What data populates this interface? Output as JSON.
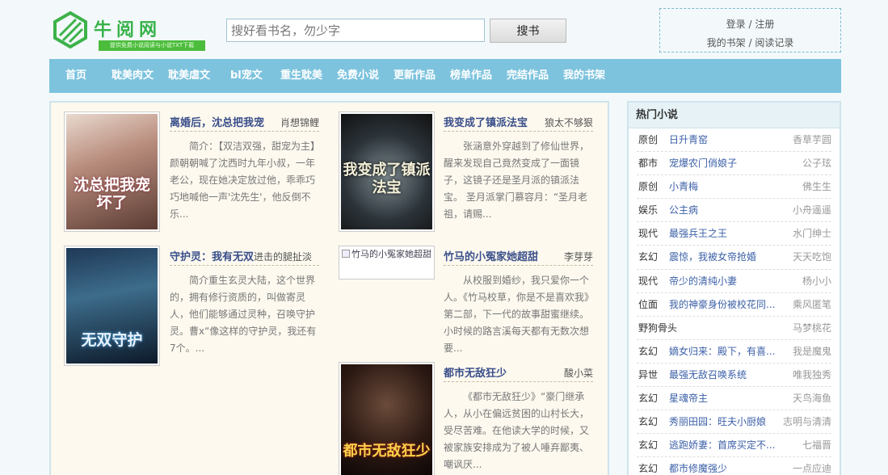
{
  "header": {
    "site_name": "牛阅网",
    "slogan": "提供免费小说阅读与小说TXT下载",
    "search_placeholder": "搜好看书名，勿少字",
    "search_button": "搜书",
    "login": "登录",
    "sep": " / ",
    "register": "注册",
    "bookshelf": "我的书架",
    "history": "阅读记录"
  },
  "nav": [
    "首页",
    "耽美肉文",
    "耽美虐文",
    "bl宠文",
    "重生耽美",
    "免费小说",
    "更新作品",
    "榜单作品",
    "完结作品",
    "我的书架"
  ],
  "books": [
    {
      "title": "离婚后，沈总把我宠",
      "author": "肖想锦鲤",
      "desc": "简介：【双洁双强，甜宠为主】颜朝朝喊了沈西时九年小叔，一年老公，现在她决定放过他，乖乖巧巧地喊他一声'沈先生'，他反倒不乐...",
      "cover_text": "沈总把我宠坏了"
    },
    {
      "title": "我变成了镇派法宝",
      "author": "狼太不够狠",
      "desc": "张涵意外穿越到了修仙世界，醒来发现自己竟然变成了一面镜子，这镜子还是圣月派的镇派法宝。 圣月派掌门慕容月：“圣月老祖，请赐...",
      "cover_text": "我变成了镇派法宝"
    },
    {
      "title": "守护灵：我有无双",
      "title_extra": "进击的腿扯淡",
      "author": "",
      "desc": "简介重生玄灵大陆，这个世界的，拥有修行资质的，叫做寄灵人，他们能够通过灵种，召唤守护灵。曹x“像这样的守护灵，我还有7个。...",
      "cover_text": "无双守护"
    },
    {
      "title": "竹马的小冤家她超甜",
      "author": "李芽芽",
      "desc": "从校服到婚纱，我只爱你一个人。《竹马校草，你是不是喜欢我》第二部，下一代的故事甜蜜继续。 小时候的路言溪每天都有无数次想要...",
      "cover_alt": "竹马的小冤家她超甜"
    },
    {
      "title": "都市无敌狂少",
      "author": "酸小菜",
      "desc": "《都市无敌狂少》“豪门继承人，从小在偏远贫困的山村长大，受尽苦难。在他读大学的时候，又被家族安排成为了被人唾弃鄙夷、嘲讽厌...",
      "cover_text": "都市无敌狂少"
    }
  ],
  "sidebar": {
    "title": "热门小说",
    "rows": [
      {
        "cat": "原创",
        "name": "日升青窑",
        "author": "香草芋圆"
      },
      {
        "cat": "都市",
        "name": "宠爆农门俏娘子",
        "author": "公子玹"
      },
      {
        "cat": "原创",
        "name": "小青梅",
        "author": "佛生生"
      },
      {
        "cat": "娱乐",
        "name": "公主病",
        "author": "小舟遥遥"
      },
      {
        "cat": "现代",
        "name": "最强兵王之王",
        "author": "水门绅士"
      },
      {
        "cat": "玄幻",
        "name": "震惊，我被女帝抢婚",
        "author": "天天吃饱"
      },
      {
        "cat": "现代",
        "name": "帝少的清纯小妻",
        "author": "杨小小"
      },
      {
        "cat": "位面",
        "name": "我的神豪身份被校花同...",
        "author": "乘风匿笔"
      },
      {
        "cat": "野狗骨头",
        "name": "",
        "author": "马梦桃花"
      },
      {
        "cat": "玄幻",
        "name": "嫡女归来：殿下，有喜...",
        "author": "我是魔鬼"
      },
      {
        "cat": "异世",
        "name": "最强无敌召唤系统",
        "author": "唯我独秀"
      },
      {
        "cat": "玄幻",
        "name": "星魂帝主",
        "author": "天鸟海鱼"
      },
      {
        "cat": "玄幻",
        "name": "秀丽田园：旺夫小厨娘",
        "author": "志明与清清"
      },
      {
        "cat": "玄幻",
        "name": "逃跑娇妻：首席买定不...",
        "author": "七福晋"
      },
      {
        "cat": "玄幻",
        "name": "都市修魔强少",
        "author": "一点应迪"
      }
    ]
  }
}
